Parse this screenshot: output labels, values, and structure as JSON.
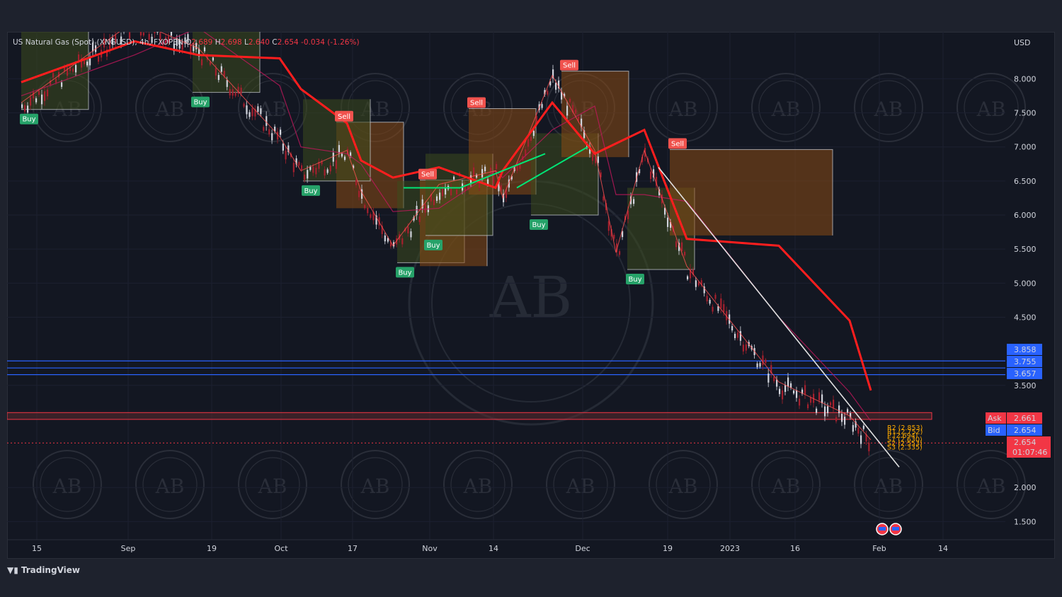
{
  "header": {
    "symbol": "US Natural Gas (Spot) (XNGUSD), 4h, FXOPEN",
    "o_label": "O",
    "o_value": "2.689",
    "h_label": "H",
    "h_value": "2.698",
    "l_label": "L",
    "l_value": "2.640",
    "c_label": "C",
    "c_value": "2.654",
    "change": "-0.034 (-1.26%)"
  },
  "currency": "USD",
  "brand": "TradingView",
  "colors": {
    "background": "#131722",
    "ma_red": "#ff1e1e",
    "buy": "#26a269",
    "sell": "#f0524d",
    "up_line": "#00e676",
    "level_blue": "#2962ff",
    "zone_orange": "#8a4b14",
    "zone_green": "#3d4a1e",
    "pivot": "#f7a600"
  },
  "chart_data": {
    "type": "line",
    "x": [
      "15",
      "Sep",
      "19",
      "Oct",
      "17",
      "Nov",
      "14",
      "Dec",
      "19",
      "2023",
      "16",
      "Feb",
      "14"
    ],
    "y_ticks": [
      "8.000",
      "7.500",
      "7.000",
      "6.500",
      "6.000",
      "5.500",
      "5.000",
      "4.500",
      "3.500",
      "2.000",
      "1.500"
    ],
    "ylim": [
      1.3,
      8.75
    ],
    "price_path": [
      {
        "x": "15",
        "y": 7.6
      },
      {
        "x": "Sep",
        "y": 8.8
      },
      {
        "x": "19",
        "y": 8.4
      },
      {
        "x": "Oct",
        "y": 7.1
      },
      {
        "x": "Oct",
        "y": 6.6
      },
      {
        "x": "17",
        "y": 6.9
      },
      {
        "x": "17",
        "y": 6.3
      },
      {
        "x": "Nov",
        "y": 5.5
      },
      {
        "x": "Nov",
        "y": 6.4
      },
      {
        "x": "14",
        "y": 6.6
      },
      {
        "x": "14",
        "y": 6.2
      },
      {
        "x": "Dec",
        "y": 8.0
      },
      {
        "x": "Dec",
        "y": 6.9
      },
      {
        "x": "19",
        "y": 5.4
      },
      {
        "x": "19",
        "y": 6.9
      },
      {
        "x": "2023",
        "y": 5.2
      },
      {
        "x": "16",
        "y": 3.5
      },
      {
        "x": "Feb",
        "y": 3.0
      },
      {
        "x": "Feb",
        "y": 2.65
      }
    ],
    "signals": [
      {
        "label": "Buy",
        "x": "15",
        "price": 7.55
      },
      {
        "label": "Buy",
        "x": "Sep",
        "price": 7.8
      },
      {
        "label": "Sell",
        "x": "Oct",
        "price": 7.3
      },
      {
        "label": "Buy",
        "x": "Oct",
        "price": 6.5
      },
      {
        "label": "Buy",
        "x": "Nov",
        "price": 5.3
      },
      {
        "label": "Sell",
        "x": "Nov",
        "price": 6.45
      },
      {
        "label": "Buy",
        "x": "Nov",
        "price": 5.7
      },
      {
        "label": "Sell",
        "x": "14",
        "price": 7.5
      },
      {
        "label": "Buy",
        "x": "14",
        "price": 6.0
      },
      {
        "label": "Sell",
        "x": "Dec",
        "price": 8.05
      },
      {
        "label": "Buy",
        "x": "19",
        "price": 5.2
      },
      {
        "label": "Sell",
        "x": "19",
        "price": 6.9
      }
    ],
    "horizontal_levels": [
      {
        "value": "3.858",
        "color": "#2962ff"
      },
      {
        "value": "3.755",
        "color": "#2962ff"
      },
      {
        "value": "3.657",
        "color": "#2962ff"
      }
    ],
    "resistance_zone": [
      3.0,
      3.1
    ],
    "pivot_labels": [
      "R2 (2.853)",
      "R1 (2.752)",
      "P (2.694)",
      "S1 (2.630)",
      "S2 (2.553)",
      "S3 (2.335)"
    ],
    "ask": {
      "label": "Ask",
      "value": "2.661"
    },
    "bid": {
      "label": "Bid",
      "value": "2.654"
    },
    "last": {
      "value": "2.654",
      "countdown": "01:07:46"
    },
    "xlabel": "",
    "ylabel": ""
  }
}
